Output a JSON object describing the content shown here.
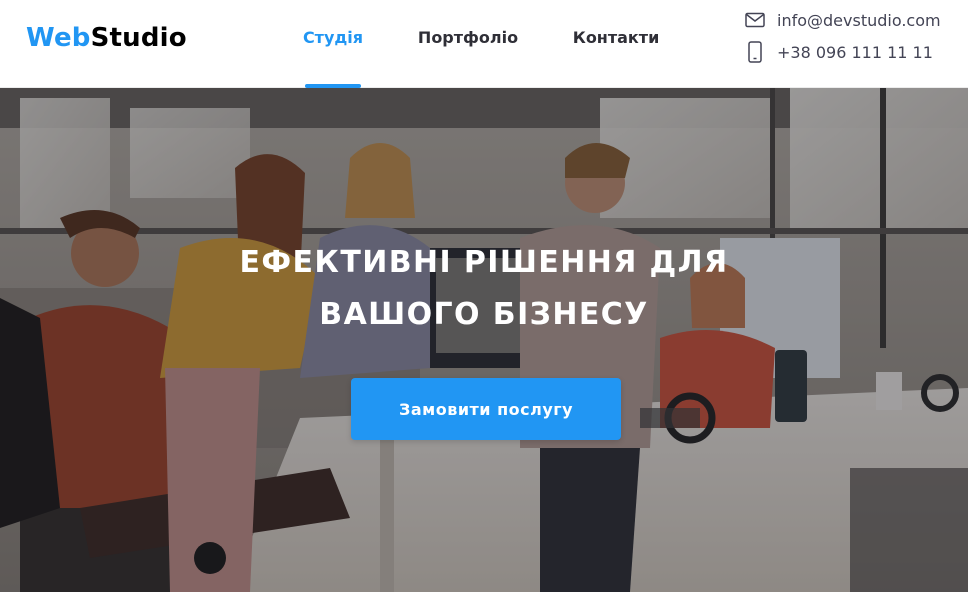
{
  "header": {
    "logo": {
      "accent": "Web",
      "rest": "Studio"
    },
    "nav": [
      {
        "label": "Студія",
        "active": true
      },
      {
        "label": "Портфоліо",
        "active": false
      },
      {
        "label": "Контакти",
        "active": false
      }
    ],
    "contacts": {
      "email": {
        "icon": "mail-icon",
        "text": "info@devstudio.com"
      },
      "phone": {
        "icon": "smartphone-icon",
        "text": "+38 096 111 11 11"
      }
    }
  },
  "hero": {
    "title_line1": "Ефективні рішення для",
    "title_line2": "вашого бізнесу",
    "cta_label": "Замовити послугу",
    "background": "office-team-photo"
  },
  "colors": {
    "accent": "#2196f3",
    "text_dark": "#2f2f37",
    "text_muted": "#434455"
  }
}
